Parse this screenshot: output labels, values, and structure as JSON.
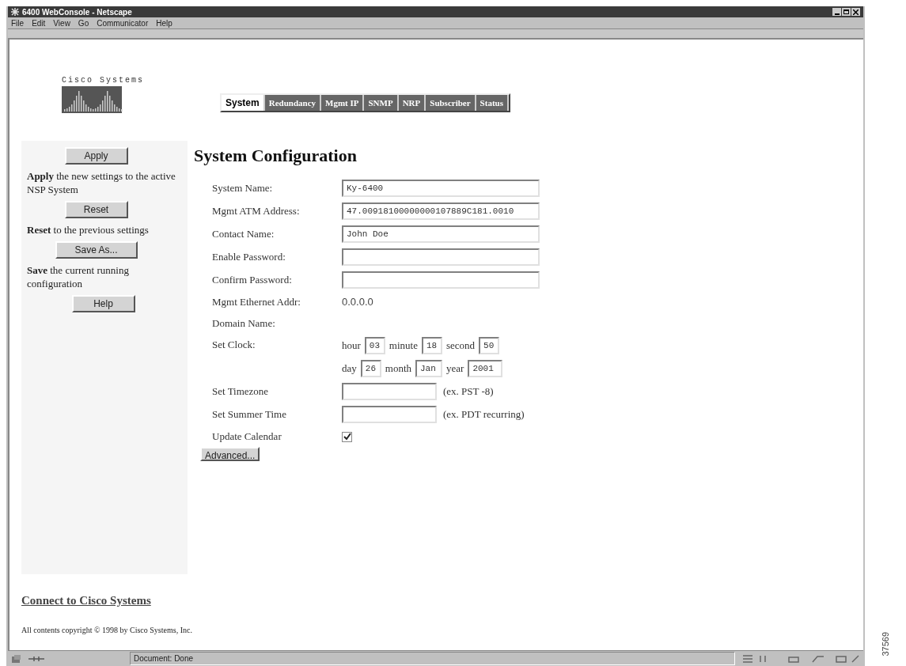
{
  "window": {
    "title": "6400 WebConsole - Netscape"
  },
  "menu": [
    "File",
    "Edit",
    "View",
    "Go",
    "Communicator",
    "Help"
  ],
  "logo": {
    "text": "Cisco Systems"
  },
  "tabs": [
    {
      "label": "System",
      "selected": true
    },
    {
      "label": "Redundancy",
      "selected": false
    },
    {
      "label": "Mgmt IP",
      "selected": false
    },
    {
      "label": "SNMP",
      "selected": false
    },
    {
      "label": "NRP",
      "selected": false
    },
    {
      "label": "Subscriber",
      "selected": false
    },
    {
      "label": "Status",
      "selected": false
    }
  ],
  "sidebar": [
    {
      "button": "Apply",
      "description": "**Apply** the new settings to the active NSP System"
    },
    {
      "button": "Reset",
      "description": "**Reset** to the previous settings"
    },
    {
      "button": "Save As...",
      "description": "**Save** the current running configuration"
    },
    {
      "button": "Help"
    }
  ],
  "heading": "System Configuration",
  "fields": [
    {
      "kind": "input",
      "label": "System Name:",
      "value": "Ky-6400"
    },
    {
      "kind": "input",
      "label": "Mgmt ATM Address:",
      "value": "47.00918100000000107889C181.0010"
    },
    {
      "kind": "input",
      "label": "Contact Name:",
      "value": "John Doe"
    },
    {
      "kind": "input",
      "label": "Enable Password:"
    },
    {
      "kind": "input",
      "label": "Confirm Password:"
    },
    {
      "kind": "text",
      "label": "Mgmt Ethernet Addr:",
      "value": "0.0.0.0"
    },
    {
      "kind": "text",
      "label": "Domain Name:"
    },
    {
      "kind": "clock",
      "label": "Set Clock:",
      "parts": [
        [
          {
            "unit": "hour",
            "value": "03"
          },
          {
            "unit": "minute",
            "value": "18"
          },
          {
            "unit": "second",
            "value": "50"
          }
        ],
        [
          {
            "unit": "day",
            "value": "26"
          },
          {
            "unit": "month",
            "value": "Jan"
          },
          {
            "unit": "year",
            "value": "2001"
          }
        ]
      ]
    },
    {
      "kind": "short",
      "label": "Set Timezone",
      "hint": "(ex. PST -8)"
    },
    {
      "kind": "short",
      "label": "Set Summer Time",
      "hint": "(ex. PDT recurring)"
    },
    {
      "kind": "checkbox",
      "label": "Update Calendar",
      "checked": true
    }
  ],
  "advanced_button": "Advanced...",
  "link": "Connect to Cisco Systems",
  "copyright": "All contents copyright © 1998 by Cisco Systems, Inc.",
  "status_bar": {
    "text": "Document: Done"
  },
  "figure_number": "37569"
}
